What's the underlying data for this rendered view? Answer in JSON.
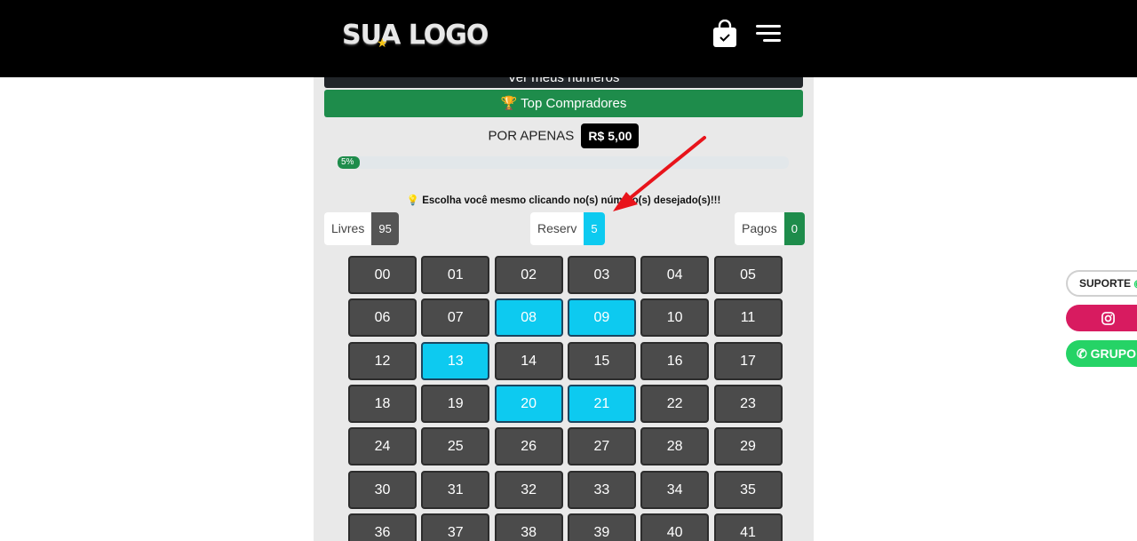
{
  "header": {
    "logo_text": "SUA LOGO",
    "cart_icon": "shopping-bag-check-icon",
    "menu_icon": "hamburger-menu-icon"
  },
  "buttons": {
    "my_numbers_label": "Ver meus números",
    "top_buyers_label": "Top Compradores"
  },
  "price": {
    "label": "POR APENAS",
    "value": "R$ 5,00"
  },
  "progress": {
    "percent": 5,
    "label": "5%"
  },
  "hint": "Escolha você mesmo clicando no(s) número(s) desejado(s)!!!",
  "stats": {
    "free_label": "Livres",
    "free_value": "95",
    "reserved_label": "Reserv",
    "reserved_value": "5",
    "paid_label": "Pagos",
    "paid_value": "0"
  },
  "numbers": [
    "00",
    "01",
    "02",
    "03",
    "04",
    "05",
    "06",
    "07",
    "08",
    "09",
    "10",
    "11",
    "12",
    "13",
    "14",
    "15",
    "16",
    "17",
    "18",
    "19",
    "20",
    "21",
    "22",
    "23",
    "24",
    "25",
    "26",
    "27",
    "28",
    "29",
    "30",
    "31",
    "32",
    "33",
    "34",
    "35",
    "36",
    "37",
    "38",
    "39",
    "40",
    "41"
  ],
  "reserved_numbers": [
    "08",
    "09",
    "13",
    "20",
    "21"
  ],
  "side_buttons": {
    "support_label": "SUPORTE",
    "group_label": "GRUPO"
  },
  "colors": {
    "green": "#1e8c4b",
    "reserved": "#0dcaf0",
    "free_badge": "#555555",
    "instagram": "#d81b60",
    "whatsapp": "#25d366",
    "arrow": "#e8141b"
  }
}
